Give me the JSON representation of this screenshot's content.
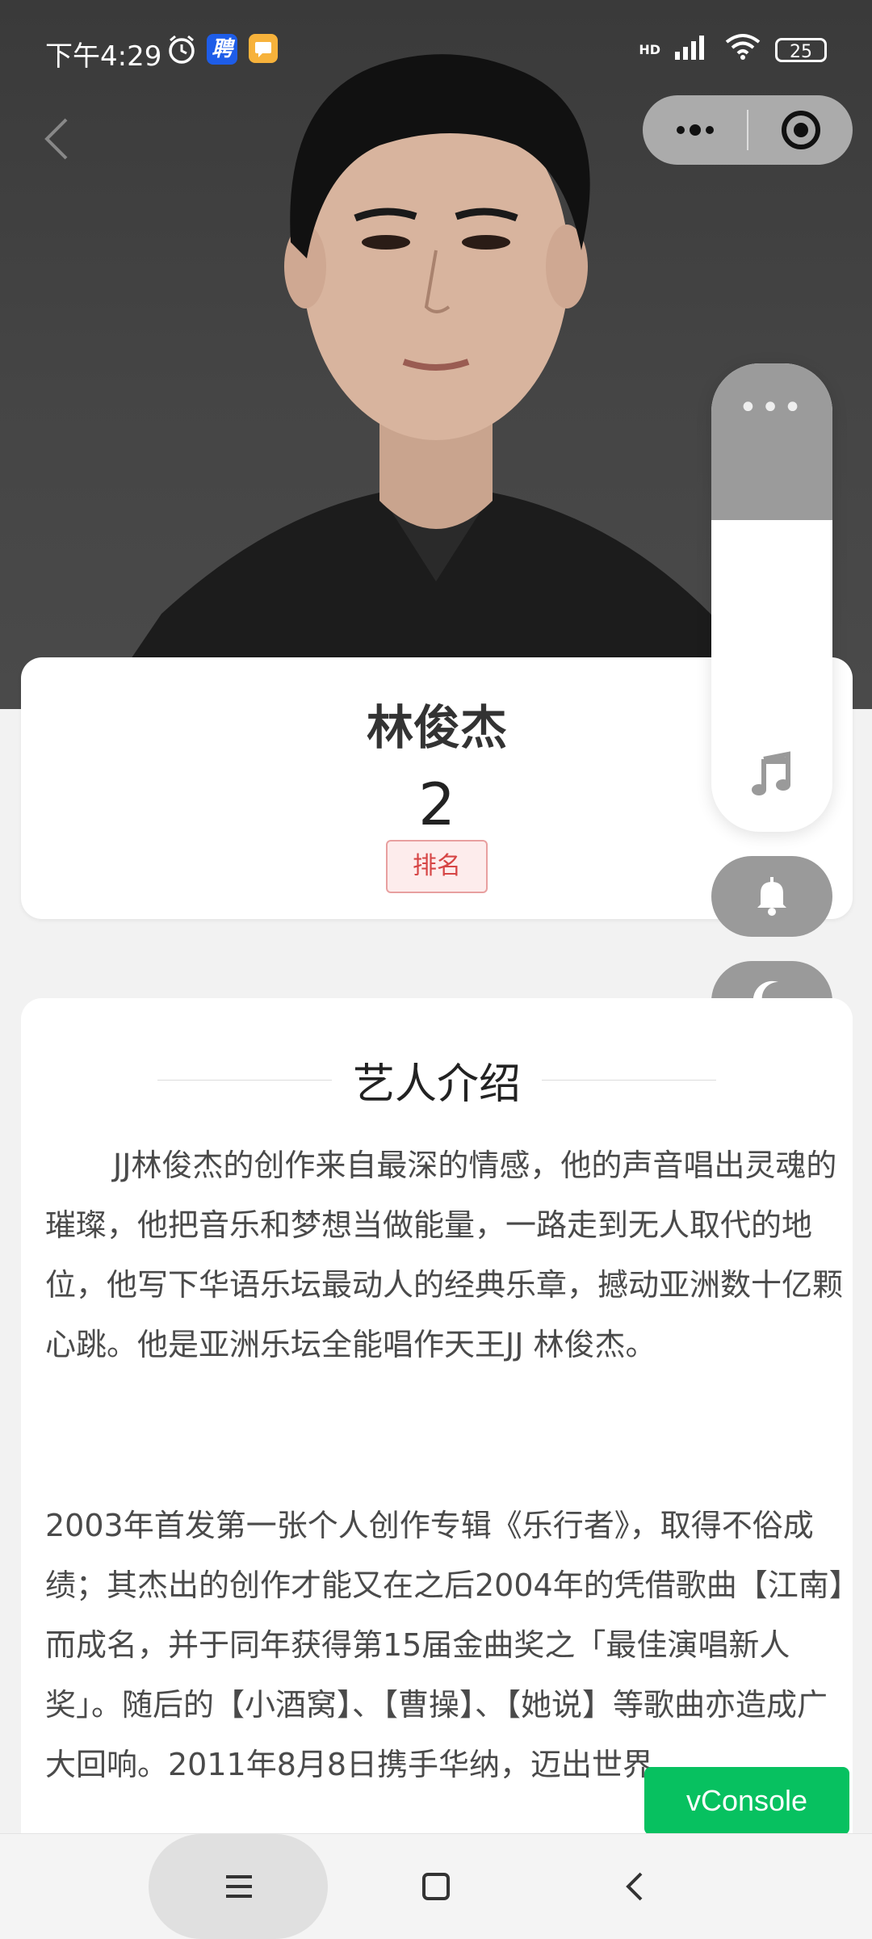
{
  "status_bar": {
    "time": "下午4:29",
    "app_badge_text": "聘",
    "battery": "25",
    "network": "HD"
  },
  "header": {
    "capsule_more_icon": "more-dots-icon",
    "capsule_close_icon": "target-circle-icon"
  },
  "artist": {
    "name": "林俊杰",
    "rank": "2",
    "rank_label": "排名"
  },
  "side_controls": {
    "dots": "•••",
    "music_icon": "music-note-icon",
    "bell_icon": "bell-icon",
    "moon_icon": "moon-icon"
  },
  "intro": {
    "title": "艺人介绍",
    "paragraph1": "JJ林俊杰的创作来自最深的情感，他的声音唱出灵魂的璀璨，他把音乐和梦想当做能量，一路走到无人取代的地位，他写下华语乐坛最动人的经典乐章，撼动亚洲数十亿颗心跳。他是亚洲乐坛全能唱作天王JJ 林俊杰。",
    "paragraph2": "2003年首发第一张个人创作专辑《乐行者》，取得不俗成绩；其杰出的创作才能又在之后2004年的凭借歌曲【江南】而成名，并于同年获得第15届金曲奖之「最佳演唱新人奖」。随后的【小酒窝】、【曹操】、【她说】等歌曲亦造成广大回响。2011年8月8日携手华纳，迈出世界。"
  },
  "vconsole": {
    "label": "vConsole"
  },
  "nav": {
    "menu_icon": "menu-icon",
    "home_icon": "home-square-icon",
    "back_icon": "back-chevron-icon"
  }
}
